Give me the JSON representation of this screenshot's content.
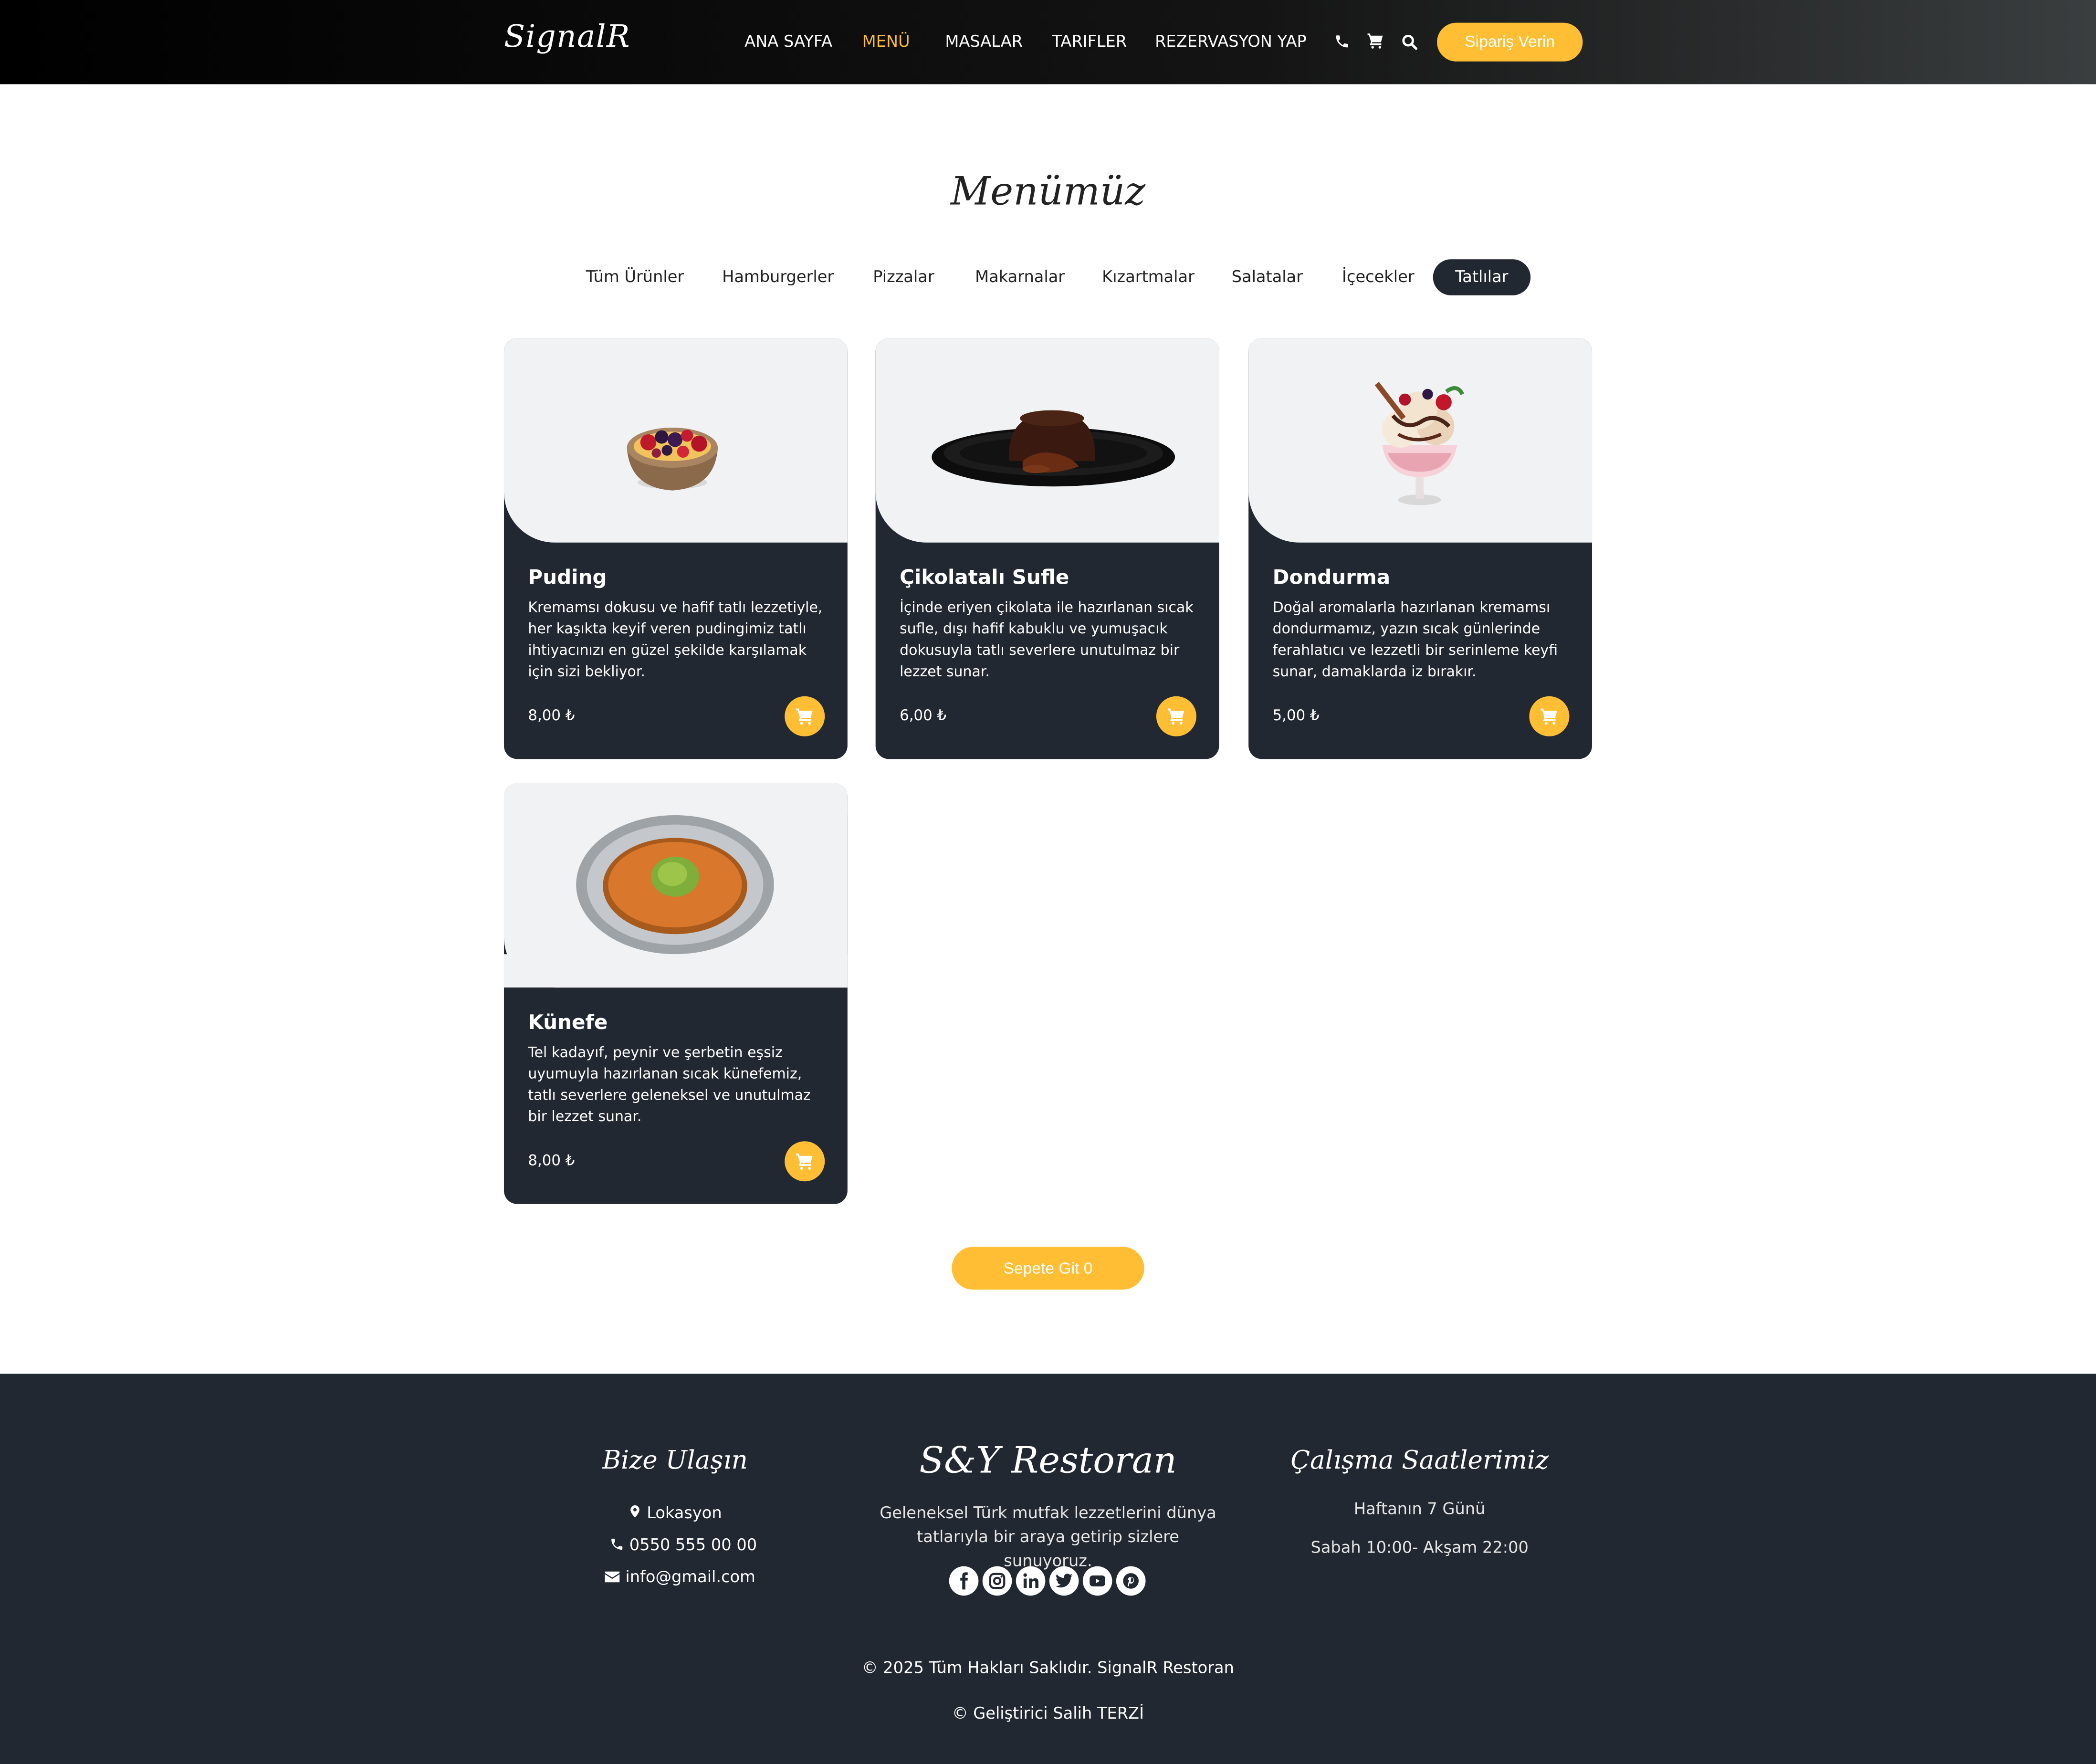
{
  "header": {
    "logo": "SignalR",
    "nav": [
      "ANA SAYFA",
      "MENÜ",
      "MASALAR",
      "TARIFLER",
      "REZERVASYON YAP"
    ],
    "active_nav": "MENÜ",
    "icons": [
      "phone-icon",
      "cart-icon",
      "search-icon"
    ],
    "order_button": "Sipariş Verin"
  },
  "menu": {
    "title": "Menümüz",
    "filters": [
      "Tüm Ürünler",
      "Hamburgerler",
      "Pizzalar",
      "Makarnalar",
      "Kızartmalar",
      "Salatalar",
      "İçecekler",
      "Tatlılar"
    ],
    "active_filter": "Tatlılar",
    "items": [
      {
        "name": "Puding",
        "description": "Kremamsı dokusu ve hafif tatlı lezzetiyle, her kaşıkta keyif veren pudingimiz tatlı ihtiyacınızı en güzel şekilde karşılamak için sizi bekliyor.",
        "price": "8,00 ₺",
        "image": "pudding-bowl-image"
      },
      {
        "name": "Çikolatalı Sufle",
        "description": "İçinde eriyen çikolata ile hazırlanan sıcak sufle, dışı hafif kabuklu ve yumuşacık dokusuyla tatlı severlere unutulmaz bir lezzet sunar.",
        "price": "6,00 ₺",
        "image": "chocolate-souffle-image"
      },
      {
        "name": "Dondurma",
        "description": "Doğal aromalarla hazırlanan kremamsı dondurmamız, yazın sıcak günlerinde ferahlatıcı ve lezzetli bir serinleme keyfi sunar, damaklarda iz bırakır.",
        "price": "5,00 ₺",
        "image": "ice-cream-cup-image"
      },
      {
        "name": "Künefe",
        "description": "Tel kadayıf, peynir ve şerbetin eşsiz uyumuyla hazırlanan sıcak künefemiz, tatlı severlere geleneksel ve unutulmaz bir lezzet sunar.",
        "price": "8,00 ₺",
        "image": "kunefe-plate-image"
      }
    ],
    "cart_button": "Sepete Git 0"
  },
  "footer": {
    "contact_title": "Bize Ulaşın",
    "location": "Lokasyon",
    "phone": "0550 555 00 00",
    "email": "info@gmail.com",
    "brand_title": "S&Y Restoran",
    "brand_text": "Geleneksel Türk mutfak lezzetlerini dünya tatlarıyla bir araya getirip sizlere sunuyoruz.",
    "social": [
      "facebook-icon",
      "instagram-icon",
      "linkedin-icon",
      "twitter-icon",
      "youtube-icon",
      "pinterest-icon"
    ],
    "hours_title": "Çalışma Saatlerimiz",
    "hours_days": "Haftanın 7 Günü",
    "hours_time": "Sabah 10:00- Akşam 22:00",
    "copyright": "© 2025 Tüm Hakları Saklıdır. SignalR Restoran",
    "developer": "© Geliştirici Salih TERZİ"
  },
  "colors": {
    "accent": "#ffbe33",
    "dark": "#222831",
    "card_image_bg": "#f1f2f3"
  }
}
